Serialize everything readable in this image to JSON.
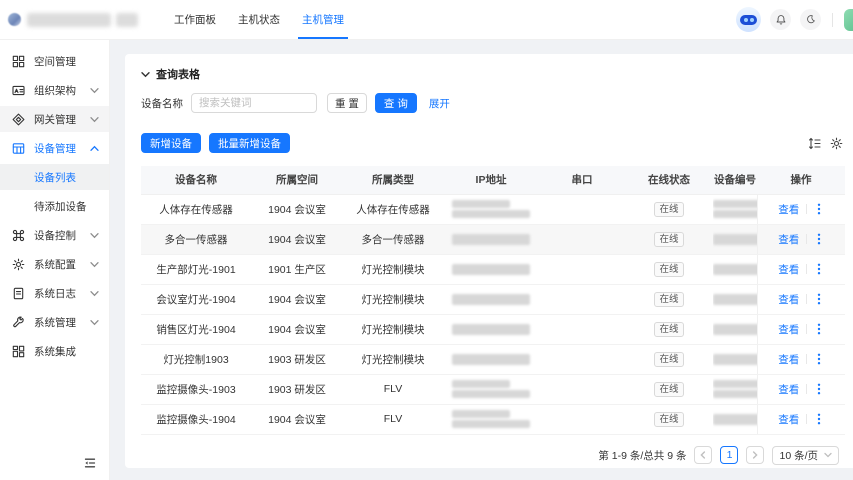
{
  "header": {
    "nav": [
      {
        "label": "工作面板",
        "active": false
      },
      {
        "label": "主机状态",
        "active": false
      },
      {
        "label": "主机管理",
        "active": true
      }
    ],
    "icons": [
      "assistant-robot",
      "bell",
      "moon",
      "user-avatar"
    ]
  },
  "sidebar": {
    "items": [
      {
        "label": "空间管理",
        "icon": "grid",
        "arrow": null
      },
      {
        "label": "组织架构",
        "icon": "idcard",
        "arrow": "down"
      },
      {
        "label": "网关管理",
        "icon": "gateway",
        "arrow": "down",
        "hover": true
      },
      {
        "label": "设备管理",
        "icon": "device",
        "arrow": "up",
        "active": true,
        "children": [
          {
            "label": "设备列表",
            "selected": true
          },
          {
            "label": "待添加设备",
            "selected": false
          }
        ]
      },
      {
        "label": "设备控制",
        "icon": "control",
        "arrow": "down"
      },
      {
        "label": "系统配置",
        "icon": "gear",
        "arrow": "down"
      },
      {
        "label": "系统日志",
        "icon": "file",
        "arrow": "down"
      },
      {
        "label": "系统管理",
        "icon": "wrench",
        "arrow": "down"
      },
      {
        "label": "系统集成",
        "icon": "blocks",
        "arrow": null
      }
    ],
    "collapse_icon": "menu-fold"
  },
  "query": {
    "title": "查询表格",
    "field_label": "设备名称",
    "placeholder": "搜索关键词",
    "reset_label": "重 置",
    "search_label": "查 询",
    "expand_label": "展开"
  },
  "toolbar": {
    "add_label": "新增设备",
    "batch_add_label": "批量新增设备",
    "icons": [
      "row-density",
      "settings-gear"
    ]
  },
  "table": {
    "columns": [
      "设备名称",
      "所属空间",
      "所属类型",
      "IP地址",
      "串口",
      "在线状态",
      "设备编号",
      "操作"
    ],
    "view_label": "查看",
    "rows": [
      {
        "name": "人体存在传感器",
        "space": "1904 会议室",
        "type": "人体存在传感器",
        "serial": "",
        "status": "在线",
        "ip_redacted": true,
        "no_redacted": true
      },
      {
        "name": "多合一传感器",
        "space": "1904 会议室",
        "type": "多合一传感器",
        "serial": "",
        "status": "在线",
        "ip_redacted": true,
        "no_redacted": true,
        "hover": true
      },
      {
        "name": "生产部灯光-1901",
        "space": "1901 生产区",
        "type": "灯光控制模块",
        "serial": "",
        "status": "在线",
        "ip_redacted": true,
        "no_redacted": true
      },
      {
        "name": "会议室灯光-1904",
        "space": "1904 会议室",
        "type": "灯光控制模块",
        "serial": "",
        "status": "在线",
        "ip_redacted": true,
        "no_redacted": true
      },
      {
        "name": "销售区灯光-1904",
        "space": "1904 会议室",
        "type": "灯光控制模块",
        "serial": "",
        "status": "在线",
        "ip_redacted": true,
        "no_redacted": true
      },
      {
        "name": "灯光控制1903",
        "space": "1903 研发区",
        "type": "灯光控制模块",
        "serial": "",
        "status": "在线",
        "ip_redacted": true,
        "no_redacted": true
      },
      {
        "name": "监控摄像头-1903",
        "space": "1903 研发区",
        "type": "FLV",
        "serial": "",
        "status": "在线",
        "ip_redacted": true,
        "no_redacted": true
      },
      {
        "name": "监控摄像头-1904",
        "space": "1904 会议室",
        "type": "FLV",
        "serial": "",
        "status": "在线",
        "ip_redacted": true,
        "no_redacted": true
      }
    ]
  },
  "pagination": {
    "total_text": "第 1-9 条/总共 9 条",
    "current_page": "1",
    "page_size": "10 条/页"
  },
  "colors": {
    "primary": "#1677ff",
    "page_bg": "#f0f2f5",
    "badge_border": "#d9d9d9"
  }
}
